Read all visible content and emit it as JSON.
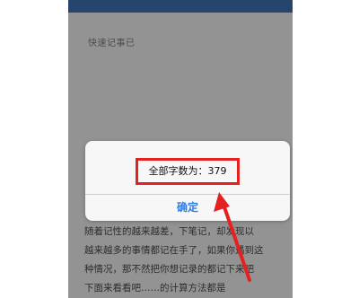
{
  "note": {
    "title": "快速记事已"
  },
  "body_lines": [
    "随着记性的越来越差，下笔记，却发现以",
    "越来越多的事情都记在手了，如果你遇到这",
    "种情况，那不然把你想记录的都记下来吧",
    "下面来看看吧……的计算方法都是"
  ],
  "dialog": {
    "message": "全部字数为：379",
    "confirm_label": "确定"
  },
  "colors": {
    "accent": "#2f7fe0",
    "highlight": "#e52120",
    "topbar": "#3f6eae"
  }
}
